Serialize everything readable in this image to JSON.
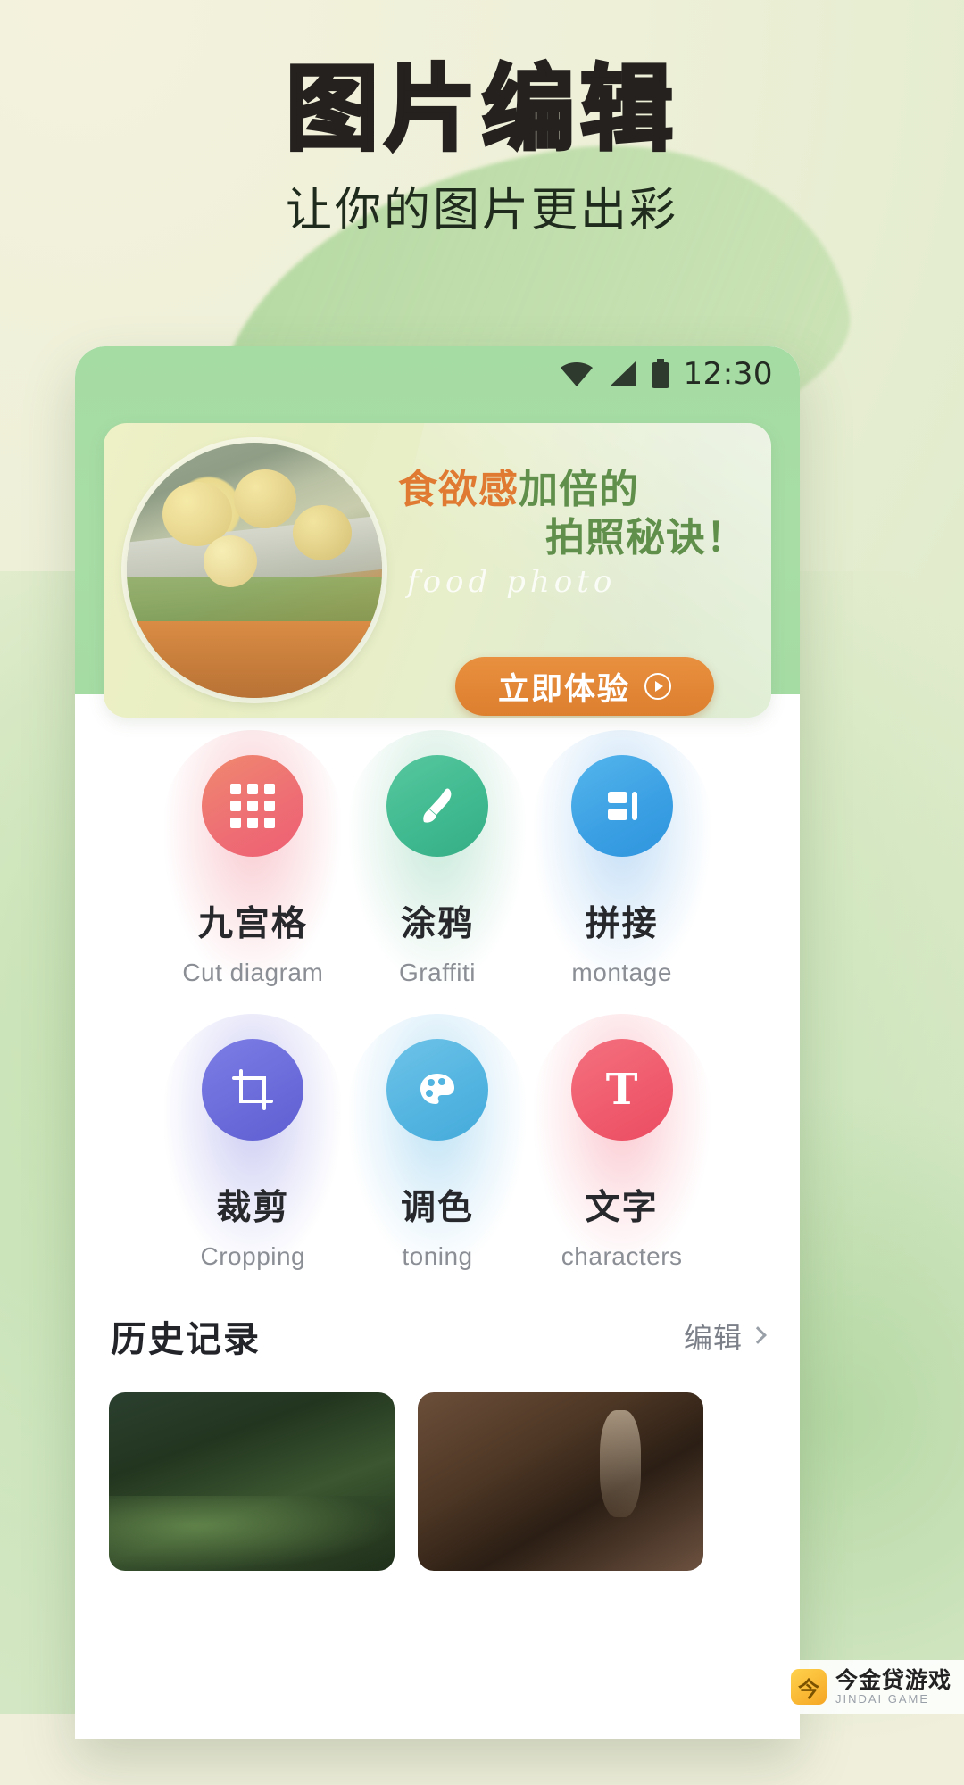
{
  "hero": {
    "title": "图片编辑",
    "subtitle": "让你的图片更出彩"
  },
  "phone": {
    "status_bar": {
      "time": "12:30",
      "wifi_icon": "wifi-icon",
      "signal_icon": "signal-icon",
      "battery_icon": "battery-icon"
    },
    "banner": {
      "headline_highlight": "食欲感",
      "headline_rest": "加倍的",
      "headline_line2": "拍照秘诀！",
      "script_text": "food photo",
      "cta_label": "立即体验",
      "cta_arrow_icon": "play-arrow-icon",
      "photo_alt": "food-photo-thumbnail"
    },
    "features": [
      {
        "cn": "九宫格",
        "en": "Cut diagram",
        "icon": "grid-nine-icon",
        "color": "#ee6f74",
        "halo": "halo-red",
        "icon_class": "ic-red"
      },
      {
        "cn": "涂鸦",
        "en": "Graffiti",
        "icon": "brush-icon",
        "color": "#3fb98f",
        "halo": "halo-green",
        "icon_class": "ic-green"
      },
      {
        "cn": "拼接",
        "en": "montage",
        "icon": "montage-icon",
        "color": "#3a9fe3",
        "halo": "halo-blue",
        "icon_class": "ic-blue"
      },
      {
        "cn": "裁剪",
        "en": "Cropping",
        "icon": "crop-icon",
        "color": "#6a6ada",
        "halo": "halo-purple",
        "icon_class": "ic-purple"
      },
      {
        "cn": "调色",
        "en": "toning",
        "icon": "palette-icon",
        "color": "#52b4e0",
        "halo": "halo-cyan",
        "icon_class": "ic-cyan"
      },
      {
        "cn": "文字",
        "en": "characters",
        "icon": "text-t-icon",
        "color": "#ef5a6c",
        "halo": "halo-pink",
        "icon_class": "ic-pink"
      }
    ],
    "history": {
      "title": "历史记录",
      "more_label": "编辑",
      "more_icon": "chevron-right-icon",
      "thumbnails": [
        "history-thumbnail-1",
        "history-thumbnail-2"
      ]
    }
  },
  "watermark": {
    "logo_glyph": "今",
    "title": "今金贷游戏",
    "subtitle": "JINDAI GAME"
  },
  "colors": {
    "accent_orange": "#e07a33",
    "accent_green": "#5f8f4a",
    "phone_header_green": "#a5dca4",
    "title_black": "#24211f"
  }
}
